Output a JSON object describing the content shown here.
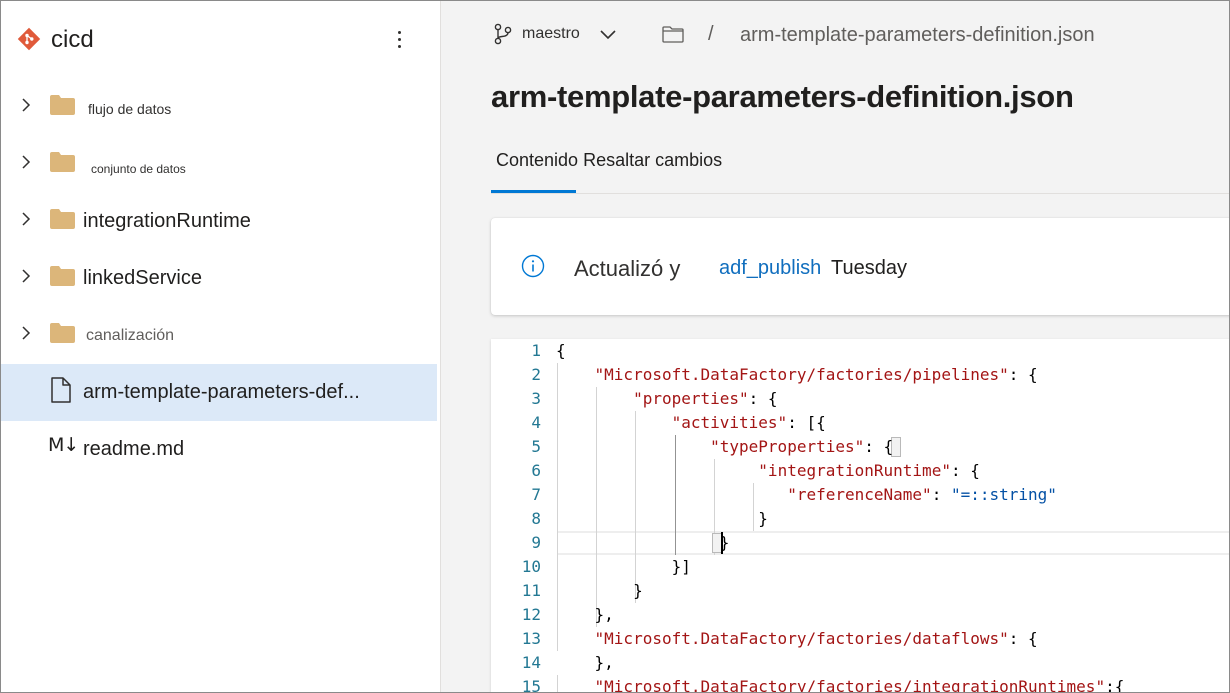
{
  "sidebar": {
    "repo_name": "cicd",
    "items": [
      {
        "label": "flujo de datos",
        "type": "folder",
        "expandable": true
      },
      {
        "label": "conjunto de datos",
        "type": "folder",
        "expandable": true
      },
      {
        "label": "integrationRuntime",
        "type": "folder",
        "expandable": true
      },
      {
        "label": "linkedService",
        "type": "folder",
        "expandable": true
      },
      {
        "label": "canalización",
        "type": "folder",
        "expandable": true
      },
      {
        "label": "arm-template-parameters-def...",
        "type": "file",
        "selected": true
      },
      {
        "label": "readme.md",
        "type": "markdown",
        "icon_text": "M↓"
      }
    ]
  },
  "topbar": {
    "branch": "maestro",
    "path_separator": "/",
    "path_file": "arm-template-parameters-definition.json"
  },
  "file_title": "arm-template-parameters-definition.json",
  "tabs": {
    "label": "Contenido Resaltar cambios"
  },
  "info": {
    "text": "Actualizó y",
    "link": "adf_publish",
    "day": "Tuesday"
  },
  "editor": {
    "lines": [
      {
        "n": "1",
        "segments": [
          {
            "t": "{",
            "c": "p"
          }
        ]
      },
      {
        "n": "2",
        "segments": [
          {
            "t": "    ",
            "c": "p"
          },
          {
            "t": "\"Microsoft.DataFactory/factories/pipelines\"",
            "c": "key"
          },
          {
            "t": ": {",
            "c": "p"
          }
        ]
      },
      {
        "n": "3",
        "segments": [
          {
            "t": "        ",
            "c": "p"
          },
          {
            "t": "\"properties\"",
            "c": "key"
          },
          {
            "t": ": {",
            "c": "p"
          }
        ]
      },
      {
        "n": "4",
        "segments": [
          {
            "t": "            ",
            "c": "p"
          },
          {
            "t": "\"activities\"",
            "c": "key"
          },
          {
            "t": ": [{",
            "c": "p"
          }
        ]
      },
      {
        "n": "5",
        "segments": [
          {
            "t": "                ",
            "c": "p"
          },
          {
            "t": "\"typeProperties\"",
            "c": "key"
          },
          {
            "t": ": {",
            "c": "p"
          }
        ]
      },
      {
        "n": "6",
        "segments": [
          {
            "t": "                     ",
            "c": "p"
          },
          {
            "t": "\"integrationRuntime\"",
            "c": "key"
          },
          {
            "t": ": {",
            "c": "p"
          }
        ]
      },
      {
        "n": "7",
        "segments": [
          {
            "t": "                        ",
            "c": "p"
          },
          {
            "t": "\"referenceName\"",
            "c": "key"
          },
          {
            "t": ": ",
            "c": "p"
          },
          {
            "t": "\"=::string\"",
            "c": "str"
          }
        ]
      },
      {
        "n": "8",
        "segments": [
          {
            "t": "                     }",
            "c": "p"
          }
        ]
      },
      {
        "n": "9",
        "segments": [
          {
            "t": "                 }",
            "c": "p"
          }
        ]
      },
      {
        "n": "10",
        "segments": [
          {
            "t": "            }]",
            "c": "p"
          }
        ]
      },
      {
        "n": "11",
        "segments": [
          {
            "t": "        }",
            "c": "p"
          }
        ]
      },
      {
        "n": "12",
        "segments": [
          {
            "t": "    },",
            "c": "p"
          }
        ]
      },
      {
        "n": "13",
        "segments": [
          {
            "t": "    ",
            "c": "p"
          },
          {
            "t": "\"Microsoft.DataFactory/factories/dataflows\"",
            "c": "key"
          },
          {
            "t": ": {",
            "c": "p"
          }
        ]
      },
      {
        "n": "14",
        "segments": [
          {
            "t": "    },",
            "c": "p"
          }
        ]
      },
      {
        "n": "15",
        "segments": [
          {
            "t": "    ",
            "c": "p"
          },
          {
            "t": "\"Microsoft.DataFactory/factories/integrationRuntimes\"",
            "c": "key"
          },
          {
            "t": ":{",
            "c": "p"
          }
        ]
      }
    ]
  },
  "colors": {
    "accent": "#0078d4",
    "link": "#106ebe",
    "selected_bg": "#dce9f8",
    "folder": "#dcb67a",
    "logo": "#e05a3a",
    "json_key": "#a31515",
    "json_string": "#0451a5",
    "line_number": "#237893"
  }
}
